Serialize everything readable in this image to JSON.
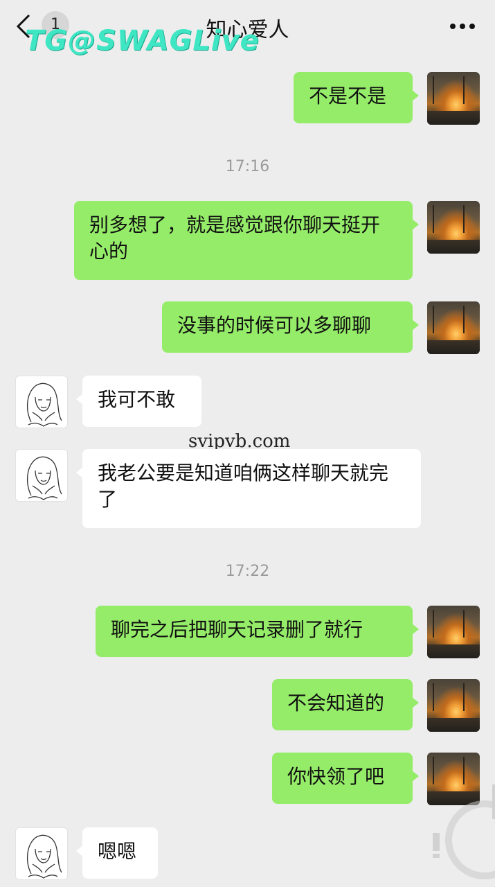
{
  "header": {
    "back_count": "1",
    "title": "知心爱人"
  },
  "watermarks": {
    "top": "TG@SWAGLive",
    "middle": "svipvb.com"
  },
  "messages": [
    {
      "side": "right",
      "text": "不是不是"
    },
    {
      "type": "time",
      "text": "17:16"
    },
    {
      "side": "right",
      "text": "别多想了，就是感觉跟你聊天挺开心的"
    },
    {
      "side": "right",
      "text": "没事的时候可以多聊聊"
    },
    {
      "side": "left",
      "text": "我可不敢"
    },
    {
      "side": "left",
      "text": "我老公要是知道咱俩这样聊天就完了"
    },
    {
      "type": "time",
      "text": "17:22"
    },
    {
      "side": "right",
      "text": "聊完之后把聊天记录删了就行"
    },
    {
      "side": "right",
      "text": "不会知道的"
    },
    {
      "side": "right",
      "text": "你快领了吧"
    },
    {
      "side": "left",
      "text": "嗯嗯"
    }
  ],
  "icons": {
    "back": "chevron-left-icon",
    "more": "more-dots-icon"
  },
  "colors": {
    "background": "#ededed",
    "bubble_self": "#95ec69",
    "bubble_other": "#ffffff",
    "watermark": "#3ee6c4"
  }
}
